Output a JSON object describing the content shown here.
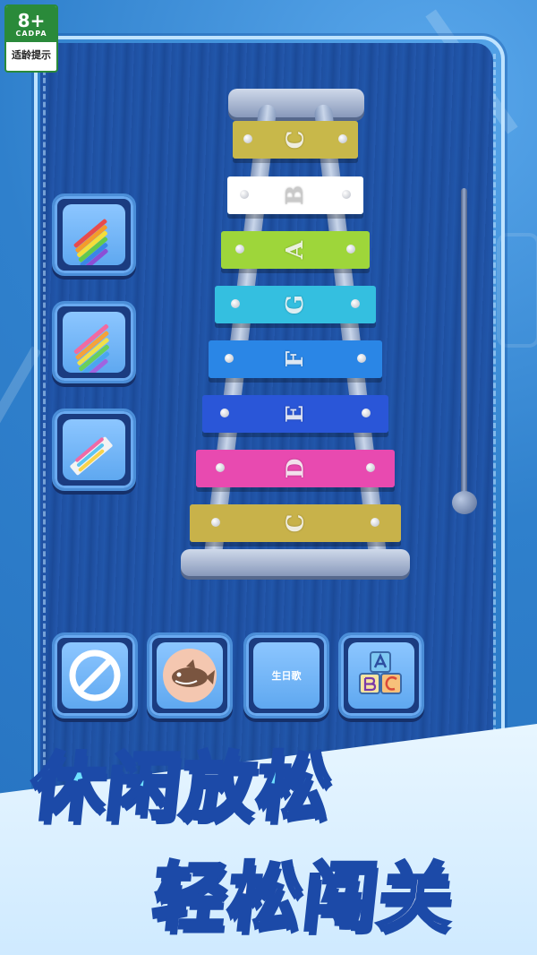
{
  "age_badge": {
    "rating": "8+",
    "org": "CADPA",
    "tip": "适龄提示"
  },
  "xylophone": {
    "bars": [
      {
        "note": "C",
        "color": "#c8b84a"
      },
      {
        "note": "B",
        "color": "#ffffff"
      },
      {
        "note": "A",
        "color": "#9ed63a"
      },
      {
        "note": "G",
        "color": "#34bfe0"
      },
      {
        "note": "F",
        "color": "#2a86e6"
      },
      {
        "note": "E",
        "color": "#2a56d8"
      },
      {
        "note": "D",
        "color": "#e84ab0"
      },
      {
        "note": "C",
        "color": "#c8b24a"
      }
    ]
  },
  "side_menu": {
    "items": [
      {
        "icon": "rainbow-xylophone-icon"
      },
      {
        "icon": "wooden-xylophone-icon"
      },
      {
        "icon": "toy-xylophone-icon"
      }
    ]
  },
  "bottom_bar": {
    "stop_icon": "no-symbol-icon",
    "shark_icon": "baby-shark-icon",
    "song_label": "生日歌",
    "abc_icon": "abc-blocks-icon"
  },
  "slogan": {
    "line1": "休闲放松",
    "line2": "轻松闯关"
  }
}
